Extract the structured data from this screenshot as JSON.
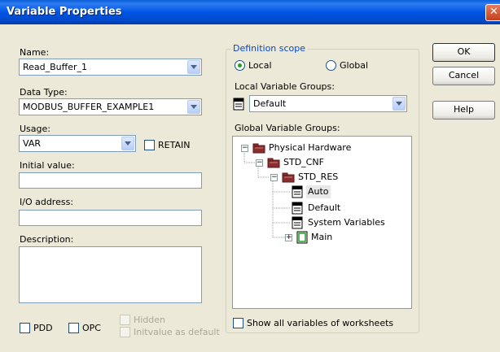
{
  "window": {
    "title": "Variable Properties",
    "close_glyph": "✕"
  },
  "left": {
    "name_label": "Name:",
    "name_value": "Read_Buffer_1",
    "datatype_label": "Data Type:",
    "datatype_value": "MODBUS_BUFFER_EXAMPLE1",
    "usage_label": "Usage:",
    "usage_value": "VAR",
    "retain_label": "RETAIN",
    "initial_label": "Initial value:",
    "initial_value": "",
    "io_label": "I/O address:",
    "io_value": "",
    "description_label": "Description:",
    "description_value": "",
    "pdd_label": "PDD",
    "opc_label": "OPC",
    "hidden_label": "Hidden",
    "initvalue_label": "Initvalue as default"
  },
  "scope": {
    "title": "Definition scope",
    "local_label": "Local",
    "global_label": "Global",
    "selected": "Local",
    "local_groups_label": "Local Variable Groups:",
    "local_group_value": "Default",
    "global_groups_label": "Global Variable Groups:",
    "tree": [
      {
        "label": "Physical Hardware",
        "icon": "folder-icon",
        "expander": "−"
      },
      {
        "label": "STD_CNF",
        "icon": "folder-icon",
        "expander": "−"
      },
      {
        "label": "STD_RES",
        "icon": "folder-icon",
        "expander": "−"
      },
      {
        "label": "Auto",
        "icon": "variable-group-icon",
        "selected": true
      },
      {
        "label": "Default",
        "icon": "variable-group-icon"
      },
      {
        "label": "System Variables",
        "icon": "variable-group-icon"
      },
      {
        "label": "Main",
        "icon": "program-icon",
        "expander": "+"
      }
    ],
    "show_all_label": "Show all variables of worksheets"
  },
  "buttons": {
    "ok": "OK",
    "cancel": "Cancel",
    "help": "Help"
  }
}
